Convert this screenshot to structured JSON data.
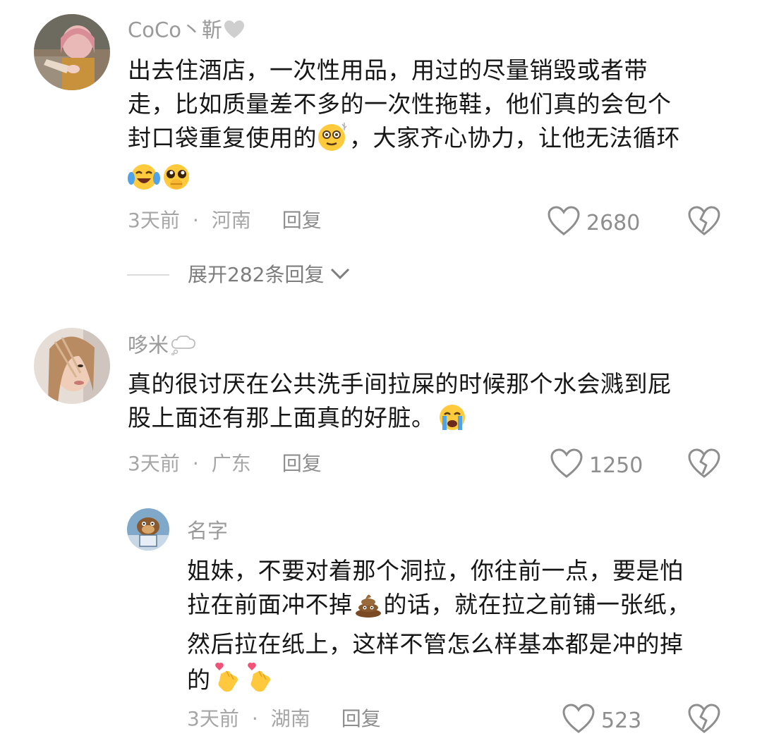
{
  "comments": [
    {
      "username": "CoCo丶靳",
      "username_icon": "grey-heart-icon",
      "lines": [
        "出去住酒店，一次性用品，用过的尽量销毁或者带",
        "走，比如质量差不多的一次性拖鞋，他们真的会包个",
        "封口袋重复使用的",
        "，大家齐心协力，让他无法循环"
      ],
      "emojis": [
        "dizzy-face-emoji",
        "crying-laughing-emoji",
        "pleading-face-emoji"
      ],
      "time": "3天前",
      "location": "河南",
      "reply_label": "回复",
      "likes": "2680"
    },
    {
      "username": "哆米",
      "username_icon": "thought-bubble-icon",
      "lines": [
        "真的很讨厌在公共洗手间拉屎的时候那个水会溅到屁",
        "股上面还有那上面真的好脏。"
      ],
      "emojis": [
        "crying-face-emoji"
      ],
      "time": "3天前",
      "location": "广东",
      "reply_label": "回复",
      "likes": "1250"
    },
    {
      "username": "名字",
      "lines": [
        "姐妹，不要对着那个洞拉，你往前一点，要是怕",
        "拉在前面冲不掉",
        "的话，就在拉之前铺一张纸，",
        "然后拉在纸上，这样不管怎么样基本都是冲的掉",
        "的"
      ],
      "emojis": [
        "poop-emoji",
        "finger-heart-emoji",
        "finger-heart-emoji"
      ],
      "time": "3天前",
      "location": "湖南",
      "reply_label": "回复",
      "likes": "523"
    }
  ],
  "expand_replies": "展开282条回复",
  "colors": {
    "text": "#161616",
    "meta": "#a6a6a6",
    "username": "#9a9a9a",
    "icon_stroke": "#8e8e8e"
  }
}
